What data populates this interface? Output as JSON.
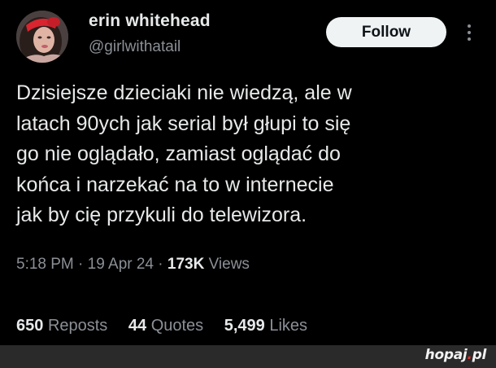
{
  "author": {
    "name": "erin whitehead",
    "handle": "@girlwithatail"
  },
  "follow_button": {
    "label": "Follow"
  },
  "tweet": {
    "lines": [
      "Dzisiejsze dzieciaki nie wiedzą, ale w",
      "latach 90ych jak serial był głupi to się",
      "go nie oglądało, zamiast oglądać do",
      "końca i narzekać na to w internecie",
      "jak by cię przykuli do telewizora."
    ]
  },
  "meta": {
    "time": "5:18 PM",
    "sep1": " · ",
    "date": "19 Apr 24",
    "sep2": " · ",
    "views_count": "173K",
    "views_label": " Views"
  },
  "stats": {
    "reposts": {
      "count": "650",
      "label": "Reposts"
    },
    "quotes": {
      "count": "44",
      "label": "Quotes"
    },
    "likes": {
      "count": "5,499",
      "label": "Likes"
    }
  },
  "watermark": {
    "main": "hopaj",
    "dot": ".",
    "tld": "pl"
  },
  "colors": {
    "background": "#000000",
    "text": "#e7e9ea",
    "secondary": "#8b9096",
    "button_bg": "#eff3f4",
    "watermark_accent": "#e62e2e"
  }
}
